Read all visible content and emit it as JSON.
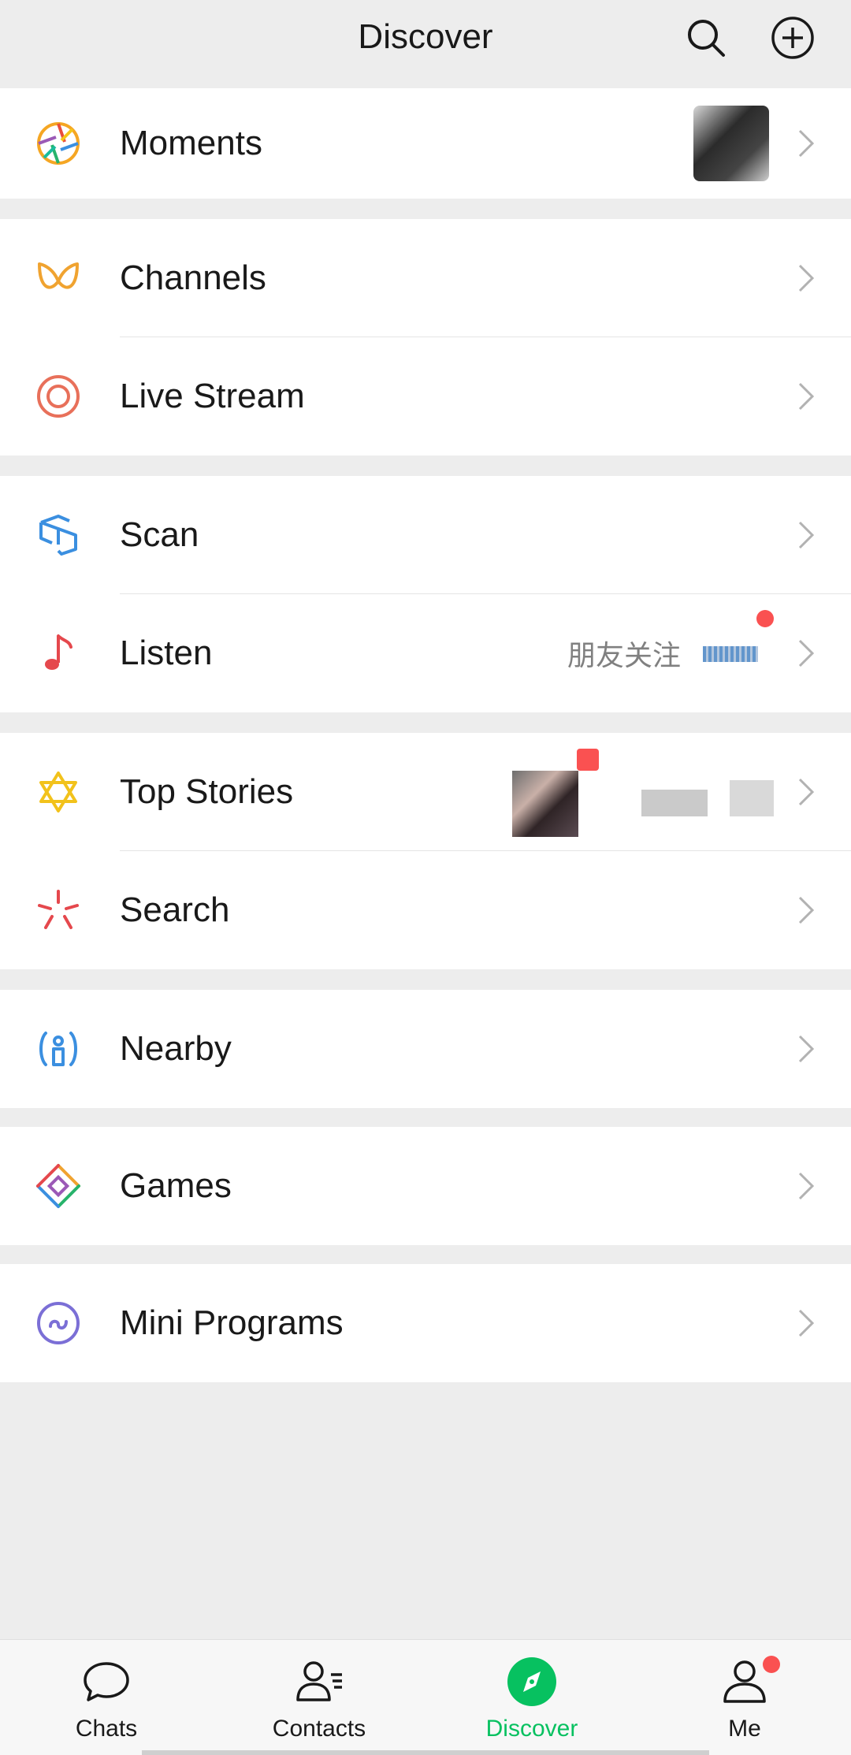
{
  "header": {
    "title": "Discover",
    "search_icon": "search-icon",
    "add_icon": "plus-circle-icon"
  },
  "colors": {
    "accent": "#07c160",
    "badge": "#fa5151",
    "background": "#ededed"
  },
  "groups": [
    {
      "items": [
        {
          "label": "Moments",
          "icon": "moments-aperture-icon"
        }
      ]
    },
    {
      "items": [
        {
          "label": "Channels",
          "icon": "channels-butterfly-icon"
        },
        {
          "label": "Live Stream",
          "icon": "live-stream-ring-icon"
        }
      ]
    },
    {
      "items": [
        {
          "label": "Scan",
          "icon": "scan-cube-icon"
        },
        {
          "label": "Listen",
          "icon": "music-note-icon",
          "subtitle": "朋友关注"
        }
      ]
    },
    {
      "items": [
        {
          "label": "Top Stories",
          "icon": "top-stories-star-icon"
        },
        {
          "label": "Search",
          "icon": "search-sparkle-icon"
        }
      ]
    },
    {
      "items": [
        {
          "label": "Nearby",
          "icon": "nearby-person-icon"
        }
      ]
    },
    {
      "items": [
        {
          "label": "Games",
          "icon": "games-diamond-icon"
        }
      ]
    },
    {
      "items": [
        {
          "label": "Mini Programs",
          "icon": "mini-programs-icon"
        }
      ]
    }
  ],
  "tabbar": {
    "tabs": [
      {
        "label": "Chats",
        "icon": "chat-bubble-icon"
      },
      {
        "label": "Contacts",
        "icon": "contacts-icon"
      },
      {
        "label": "Discover",
        "icon": "compass-icon",
        "active": true
      },
      {
        "label": "Me",
        "icon": "person-icon",
        "badge": true
      }
    ]
  }
}
